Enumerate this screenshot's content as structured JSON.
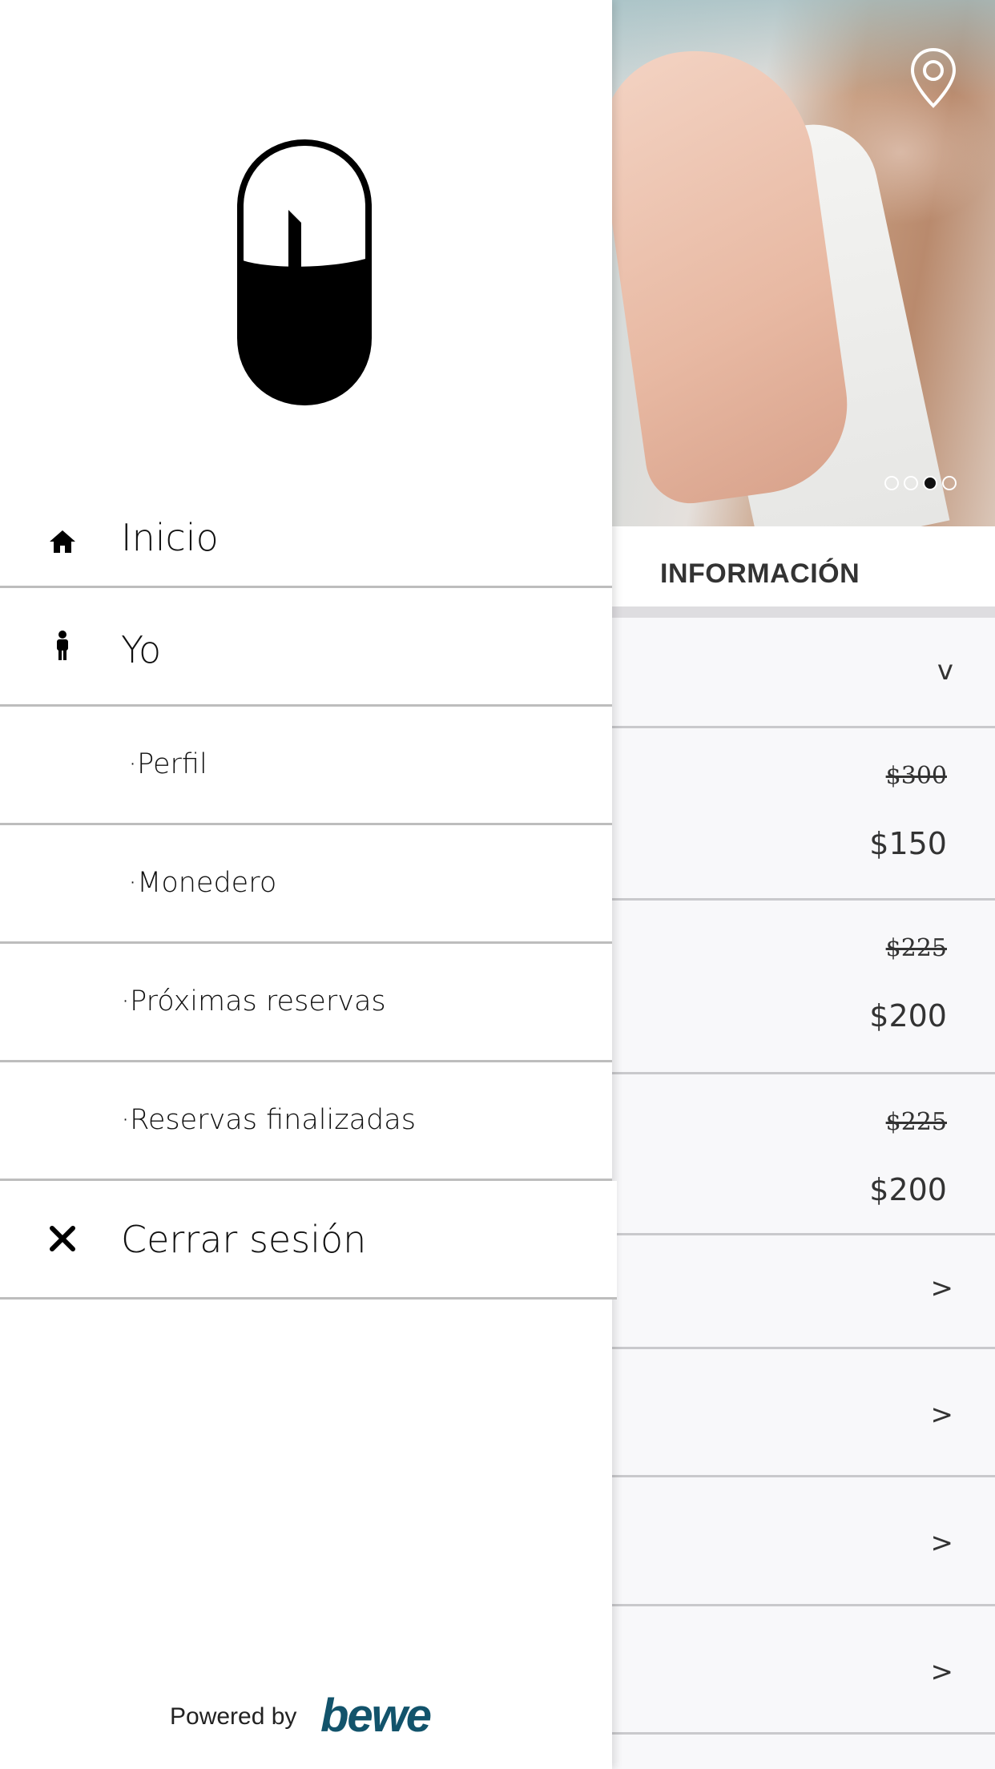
{
  "drawer": {
    "menu": [
      {
        "label": "Inicio",
        "icon": "home-icon"
      },
      {
        "label": "Yo",
        "icon": "person-icon"
      },
      {
        "label": "·Perfil"
      },
      {
        "label": "·Monedero"
      },
      {
        "label": "·Próximas reservas"
      },
      {
        "label": "·Reservas finalizadas"
      },
      {
        "label": "Cerrar sesión",
        "icon": "close-icon"
      }
    ],
    "footer": {
      "powered_by": "Powered by",
      "brand": "bewe"
    }
  },
  "page": {
    "carousel": {
      "total_slides": 4,
      "active_slide": 3
    },
    "section_title": "INFORMACIÓN",
    "rows": [
      {
        "type": "collapse",
        "chevron": "v"
      },
      {
        "type": "price",
        "old": "$300",
        "new": "$150"
      },
      {
        "type": "price",
        "old": "$225",
        "new": "$200"
      },
      {
        "type": "price",
        "old": "$225",
        "new": "$200"
      },
      {
        "type": "link",
        "chevron": ">"
      },
      {
        "type": "link",
        "chevron": ">"
      },
      {
        "type": "link",
        "chevron": ">"
      },
      {
        "type": "link",
        "chevron": ">"
      }
    ]
  },
  "colors": {
    "brand": "#12536b",
    "divider": "#bdbdbd",
    "active_dot": "#111111"
  }
}
